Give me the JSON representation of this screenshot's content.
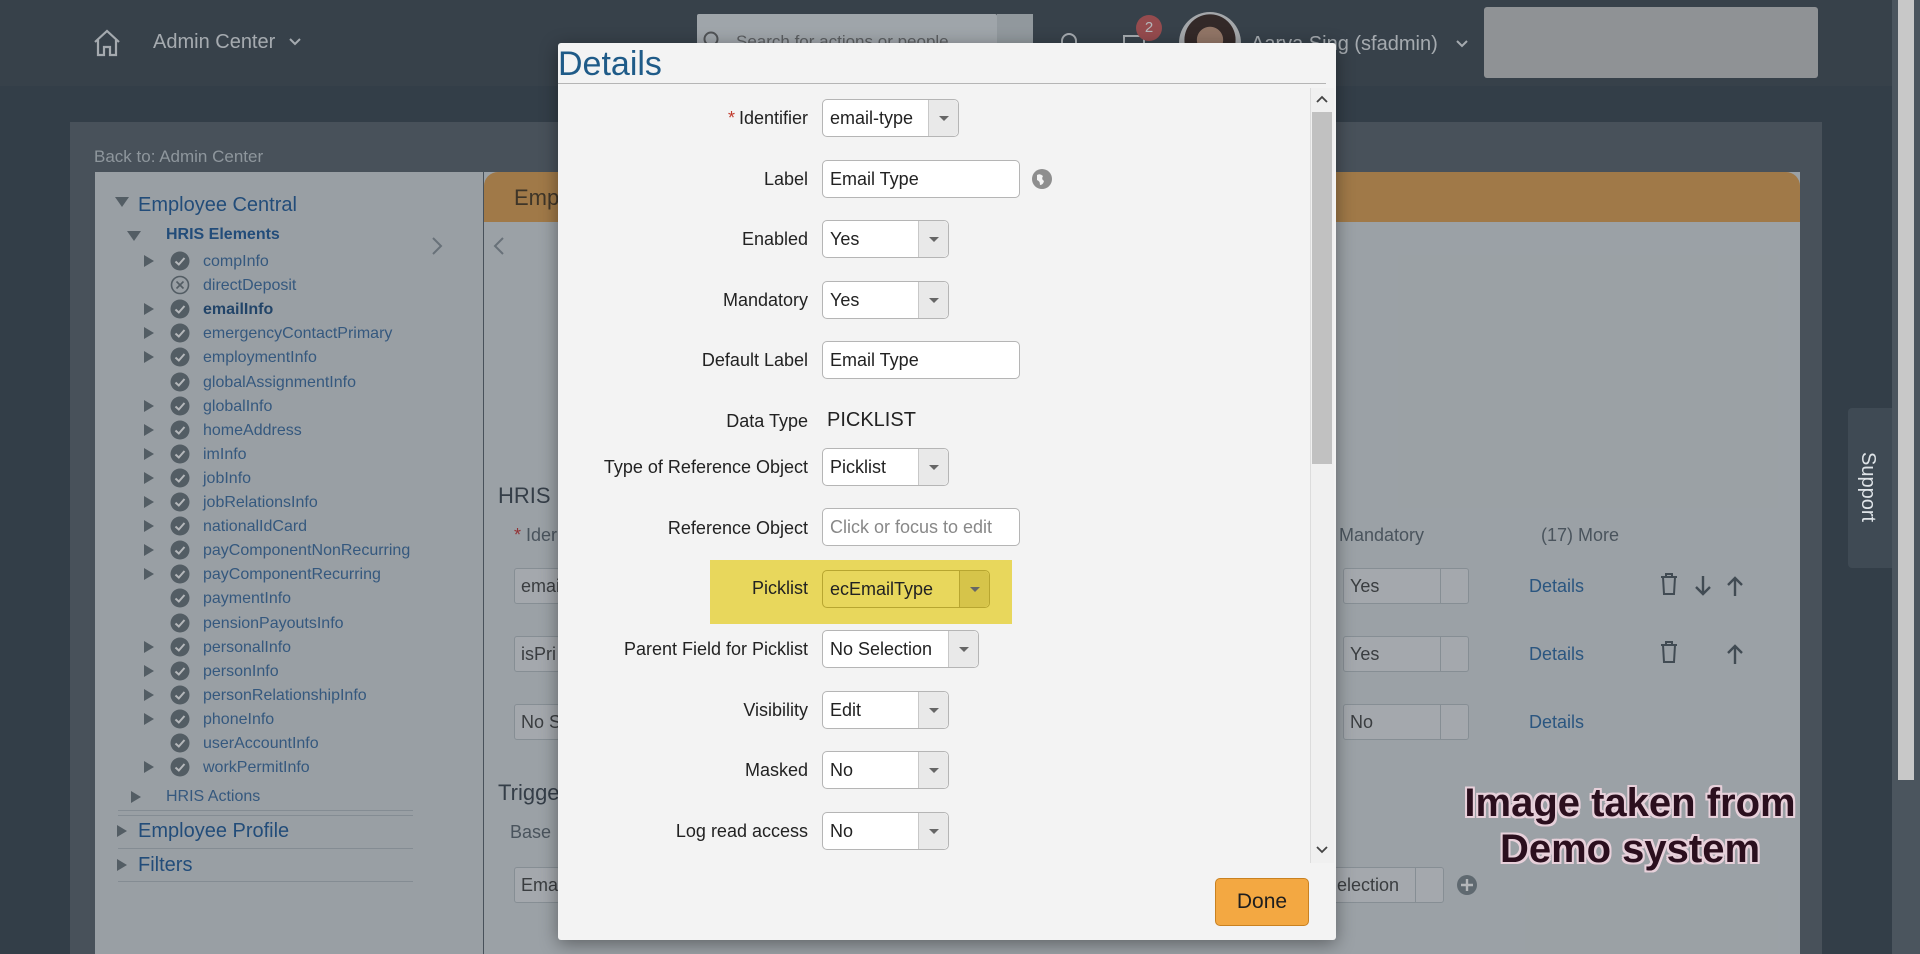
{
  "shellbar": {
    "title": "Admin Center",
    "search_placeholder": "Search for actions or people",
    "notification_count": "2",
    "user_name": "Aarya Sing (sfadmin)"
  },
  "page": {
    "back_link": "Back to: Admin Center",
    "tree": {
      "root": "Employee Central",
      "group": "HRIS Elements",
      "items": [
        "compInfo",
        "directDeposit",
        "emailInfo",
        "emergencyContactPrimary",
        "employmentInfo",
        "globalAssignmentInfo",
        "globalInfo",
        "homeAddress",
        "imInfo",
        "jobInfo",
        "jobRelationsInfo",
        "nationalIdCard",
        "payComponentNonRecurring",
        "payComponentRecurring",
        "paymentInfo",
        "pensionPayoutsInfo",
        "personalInfo",
        "personInfo",
        "personRelationshipInfo",
        "phoneInfo",
        "userAccountInfo",
        "workPermitInfo"
      ],
      "hris_actions": "HRIS Actions",
      "employee_profile": "Employee Profile",
      "filters": "Filters"
    },
    "content": {
      "header_fragment": "Emp",
      "section_fragment": "HRIS",
      "identifier_fragment": "Ider",
      "mandatory_col": "Mandatory",
      "more_col": "(17) More",
      "rows": [
        {
          "field": "emai",
          "mandatory": "Yes",
          "details": "Details"
        },
        {
          "field": "isPri",
          "mandatory": "Yes",
          "details": "Details"
        },
        {
          "field": "No S",
          "mandatory": "No",
          "details": "Details"
        }
      ],
      "trigger_fragment": "Trigge",
      "base_fragment": "Base",
      "trigger_row_field": "Ema",
      "trigger_row_select": "election"
    }
  },
  "support_label": "Support",
  "dialog": {
    "title": "Details",
    "fields": {
      "identifier": {
        "label": "Identifier",
        "value": "email-type"
      },
      "label": {
        "label": "Label",
        "value": "Email Type"
      },
      "enabled": {
        "label": "Enabled",
        "value": "Yes"
      },
      "mandatory": {
        "label": "Mandatory",
        "value": "Yes"
      },
      "default_label": {
        "label": "Default Label",
        "value": "Email Type"
      },
      "data_type": {
        "label": "Data Type",
        "value": "PICKLIST"
      },
      "type_of_reference_object": {
        "label": "Type of Reference Object",
        "value": "Picklist"
      },
      "reference_object": {
        "label": "Reference Object",
        "placeholder": "Click or focus to edit"
      },
      "picklist": {
        "label": "Picklist",
        "value": "ecEmailType"
      },
      "parent_field_for_picklist": {
        "label": "Parent Field for Picklist",
        "value": "No Selection"
      },
      "visibility": {
        "label": "Visibility",
        "value": "Edit"
      },
      "masked": {
        "label": "Masked",
        "value": "No"
      },
      "log_read_access": {
        "label": "Log read access",
        "value": "No"
      }
    },
    "done_label": "Done"
  },
  "watermark": {
    "line1": "Image taken from",
    "line2": "Demo system"
  },
  "colors": {
    "accent_orange": "#f3a842",
    "highlight_yellow": "#e8d75c",
    "title_blue": "#1f5b88"
  }
}
